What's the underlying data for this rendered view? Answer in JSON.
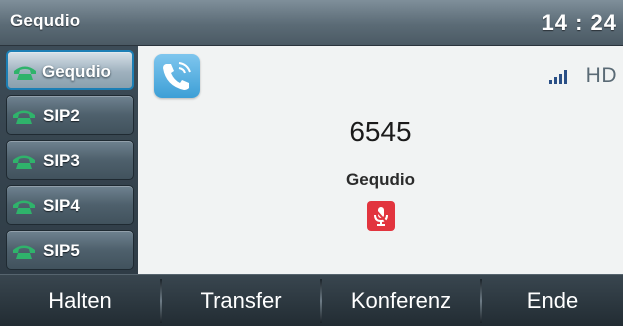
{
  "status_bar": {
    "title": "Gequdio",
    "time": "14 : 24"
  },
  "line_keys": [
    {
      "label": "Gequdio",
      "icon": "phone-handset-icon",
      "active": true
    },
    {
      "label": "SIP2",
      "icon": "phone-handset-icon",
      "active": false
    },
    {
      "label": "SIP3",
      "icon": "phone-handset-icon",
      "active": false
    },
    {
      "label": "SIP4",
      "icon": "phone-handset-icon",
      "active": false
    },
    {
      "label": "SIP5",
      "icon": "phone-handset-icon",
      "active": false
    }
  ],
  "call": {
    "state_icon": "outgoing-call-icon",
    "signal_icon": "signal-bars-icon",
    "hd_label": "HD",
    "number": "6545",
    "name": "Gequdio",
    "mute_icon": "microphone-muted-icon"
  },
  "softkeys": [
    {
      "label": "Halten"
    },
    {
      "label": "Transfer"
    },
    {
      "label": "Konferenz"
    },
    {
      "label": "Ende"
    }
  ],
  "colors": {
    "accent_blue": "#3d9fd6",
    "mute_red": "#e2343e",
    "line_green": "#2fb36b"
  }
}
